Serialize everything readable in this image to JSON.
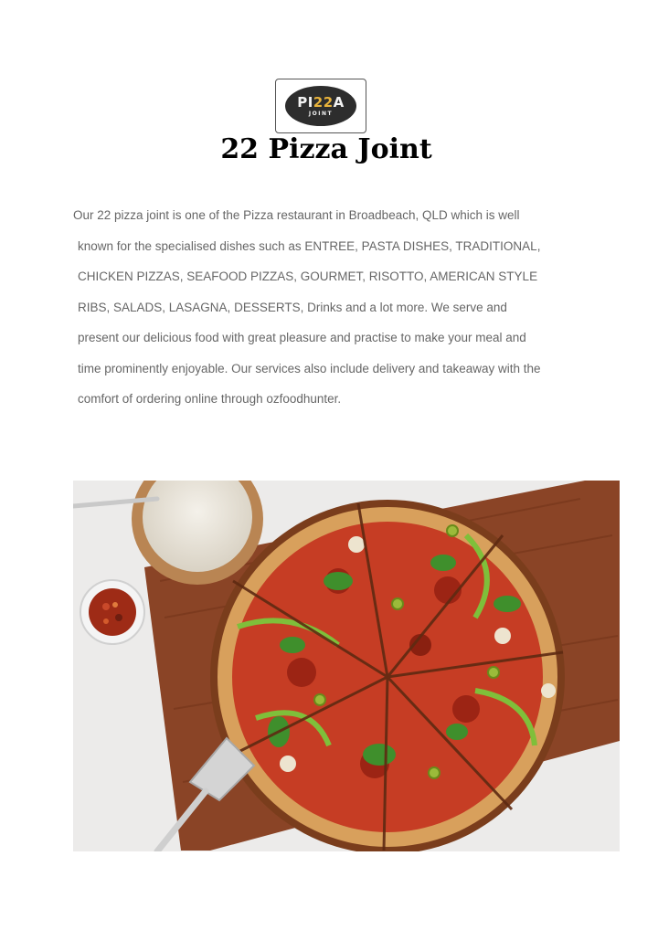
{
  "logo": {
    "main_pre": "PI",
    "main_highlight": "22",
    "main_post": "A",
    "sub": "JOINT"
  },
  "title": "22 Pizza Joint",
  "intro_lines": [
    "Our 22 pizza joint is one of the Pizza restaurant in Broadbeach, QLD which is well",
    "known for the specialised dishes such as ENTREE, PASTA DISHES, TRADITIONAL,",
    "CHICKEN PIZZAS, SEAFOOD PIZZAS, GOURMET, RISOTTO, AMERICAN STYLE",
    "RIBS, SALADS, LASAGNA, DESSERTS, Drinks and a lot more. We serve and",
    "present our delicious food with great pleasure and practise to make your meal and",
    "time prominently enjoyable. Our services also include delivery and takeaway with the",
    "comfort of ordering online through ozfoodhunter."
  ],
  "colors": {
    "logo_badge": "#2d2d2d",
    "logo_accent": "#e8b33b",
    "body_text": "#666666",
    "title_text": "#000000"
  }
}
